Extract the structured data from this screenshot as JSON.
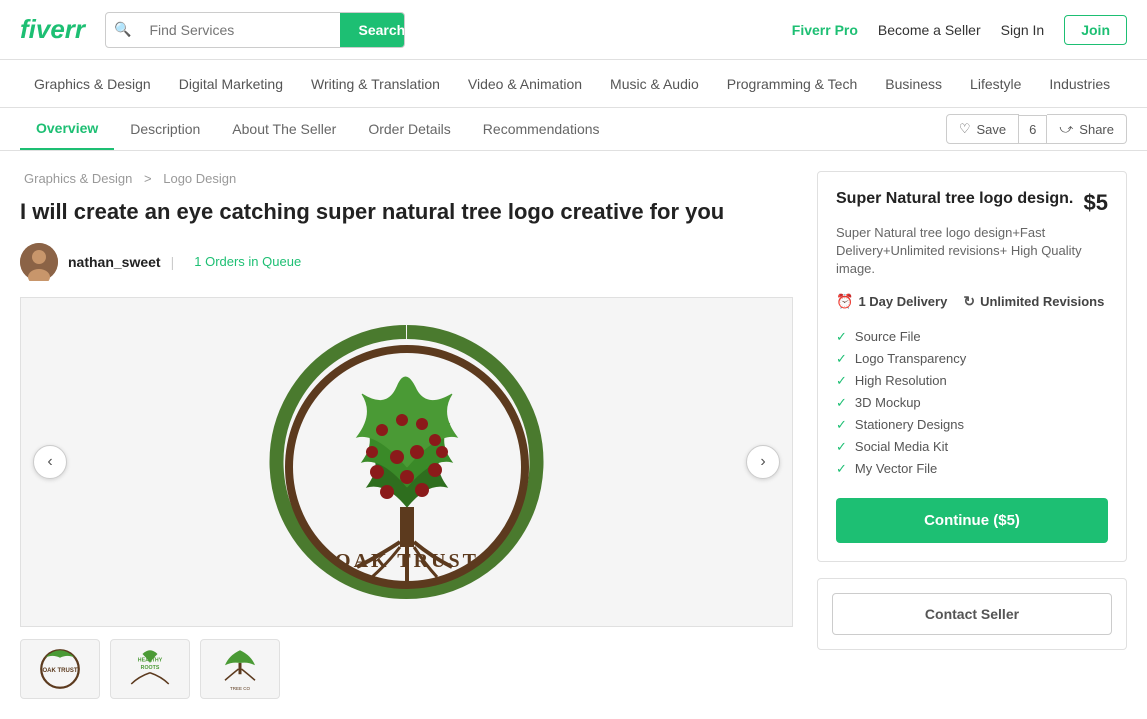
{
  "header": {
    "logo": "fiverr",
    "search_placeholder": "Find Services",
    "search_btn": "Search",
    "fiverr_pro": "Fiverr Pro",
    "become_seller": "Become a Seller",
    "sign_in": "Sign In",
    "join": "Join"
  },
  "nav": {
    "items": [
      "Graphics & Design",
      "Digital Marketing",
      "Writing & Translation",
      "Video & Animation",
      "Music & Audio",
      "Programming & Tech",
      "Business",
      "Lifestyle",
      "Industries"
    ]
  },
  "tabs": {
    "items": [
      "Overview",
      "Description",
      "About The Seller",
      "Order Details",
      "Recommendations"
    ],
    "active": "Overview",
    "save_label": "Save",
    "save_count": "6",
    "share_label": "Share"
  },
  "breadcrumb": {
    "parent": "Graphics & Design",
    "child": "Logo Design"
  },
  "gig": {
    "title": "I will create an eye catching super natural tree logo creative for you",
    "seller_name": "nathan_sweet",
    "orders_in_queue": "1 Orders in Queue"
  },
  "package": {
    "name": "Super Natural tree logo design.",
    "price": "$5",
    "description": "Super Natural tree logo design+Fast Delivery+Unlimited revisions+ High Quality image.",
    "delivery": "1 Day Delivery",
    "revisions": "Unlimited Revisions",
    "features": [
      "Source File",
      "Logo Transparency",
      "High Resolution",
      "3D Mockup",
      "Stationery Designs",
      "Social Media Kit",
      "My Vector File"
    ],
    "continue_btn": "Continue ($5)",
    "contact_btn": "Contact Seller"
  }
}
